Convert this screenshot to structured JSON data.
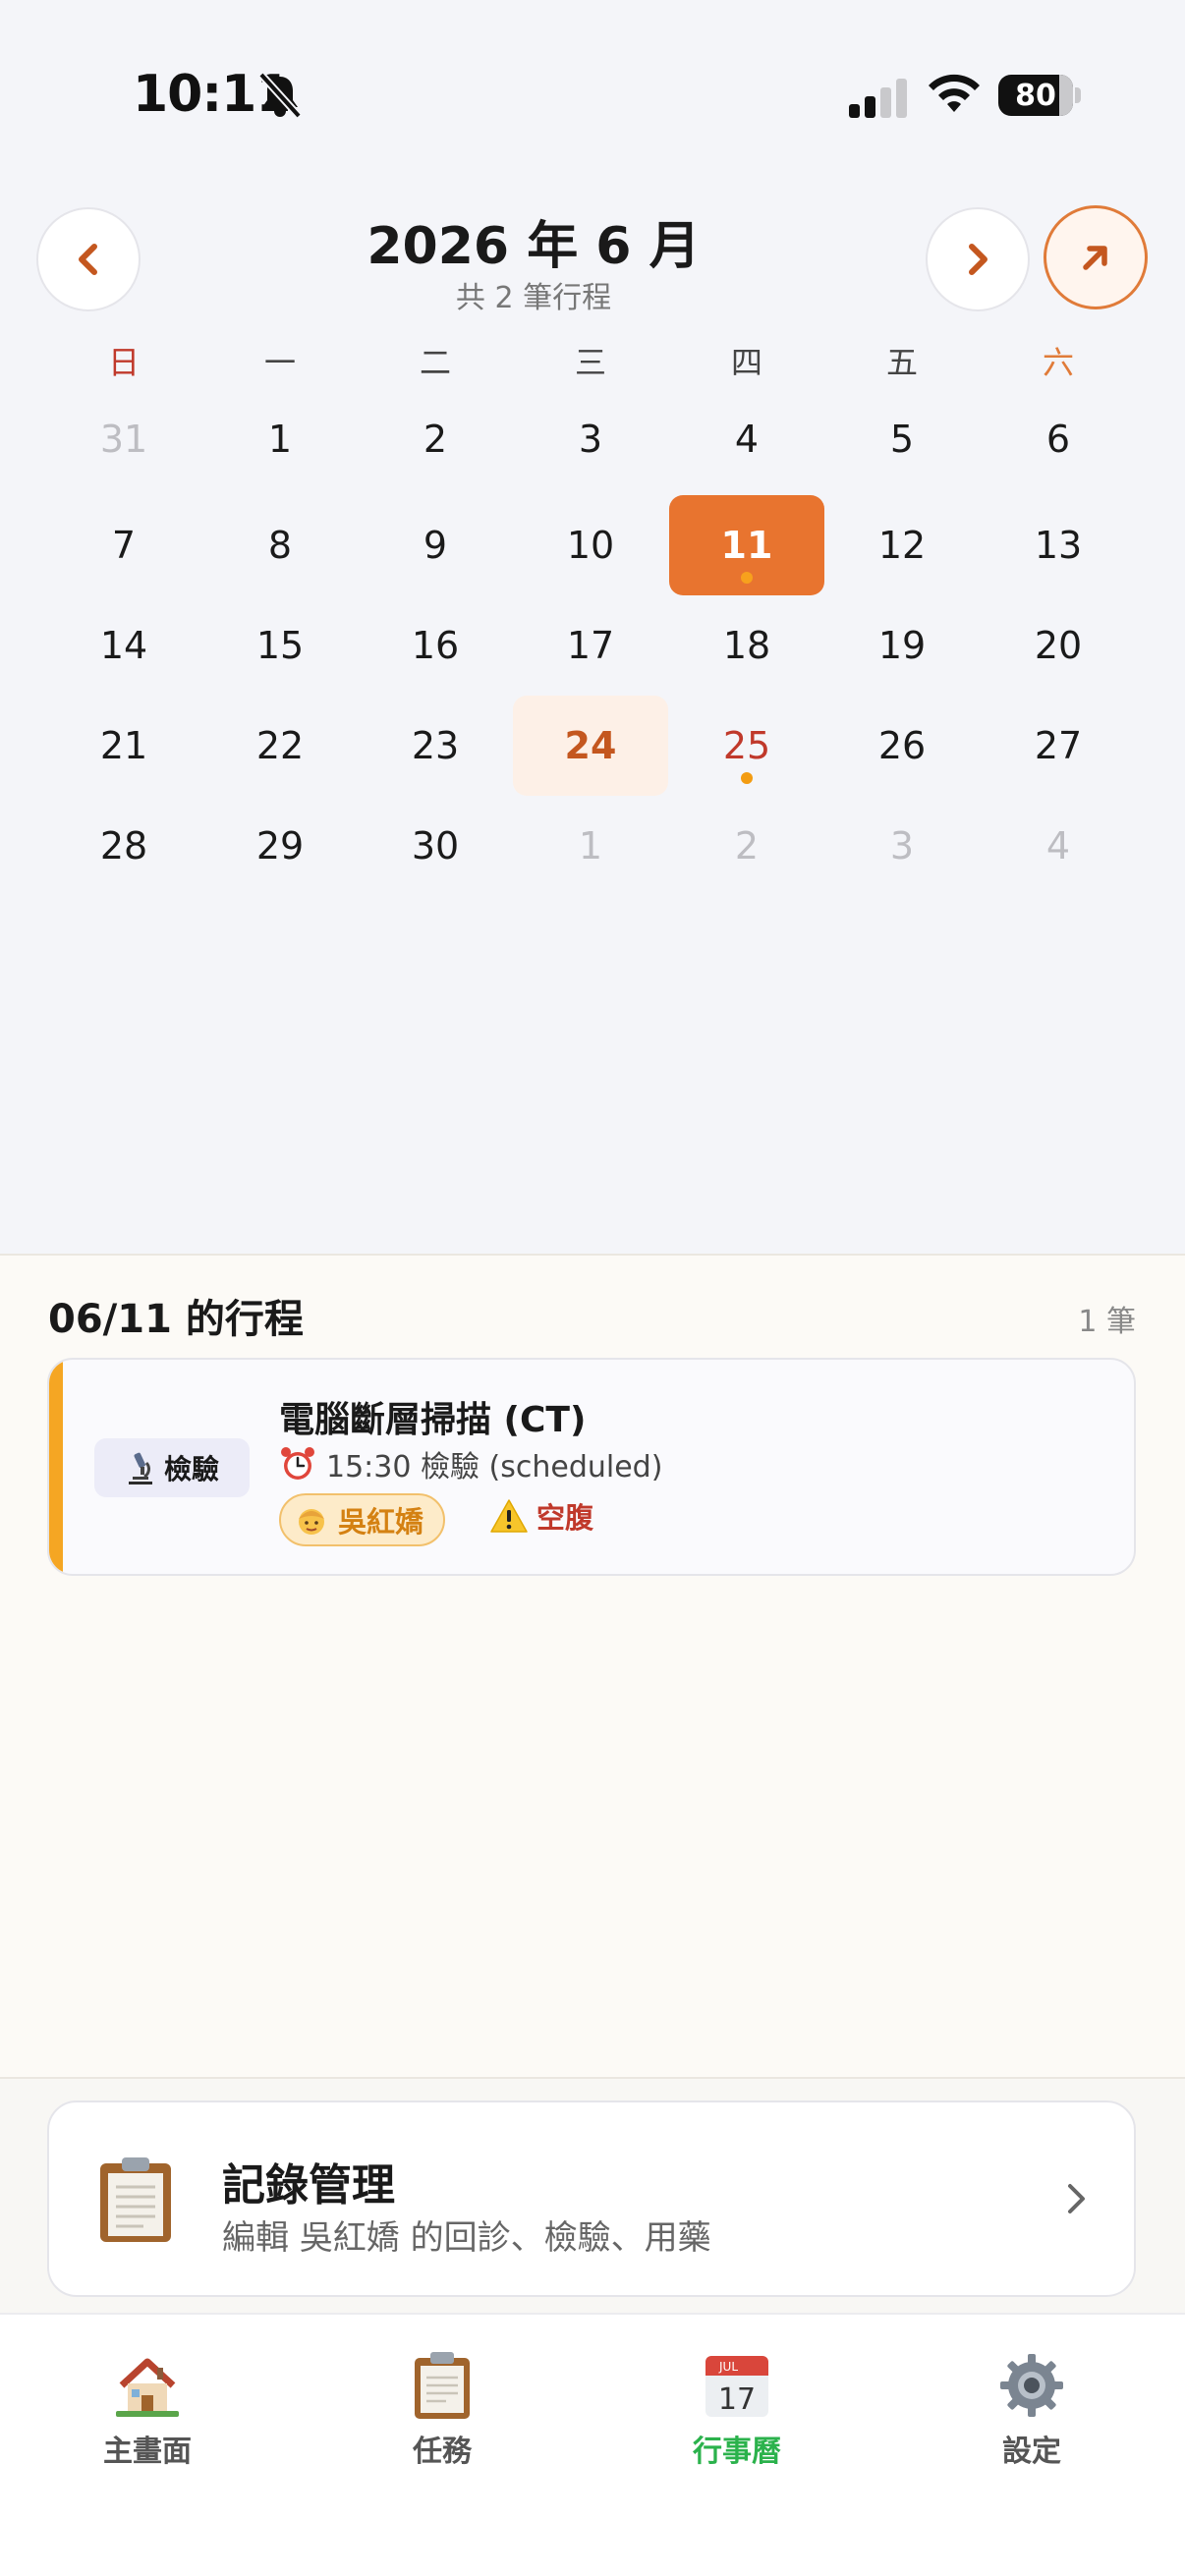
{
  "status_bar": {
    "time": "10:11",
    "battery": "80",
    "icons": [
      "bell-slash-icon",
      "cellular-signal-icon",
      "wifi-icon",
      "battery-icon"
    ]
  },
  "calendar": {
    "month_title": "2026 年 6 月",
    "subtitle": "共 2 筆行程",
    "prev_icon": "chevron-left-icon",
    "next_icon": "chevron-right-icon",
    "expand_icon": "arrow-up-right-icon",
    "weekdays": [
      "日",
      "一",
      "二",
      "三",
      "四",
      "五",
      "六"
    ],
    "days": [
      [
        "31",
        "1",
        "2",
        "3",
        "4",
        "5",
        "6"
      ],
      [
        "7",
        "8",
        "9",
        "10",
        "11",
        "12",
        "13"
      ],
      [
        "14",
        "15",
        "16",
        "17",
        "18",
        "19",
        "20"
      ],
      [
        "21",
        "22",
        "23",
        "24",
        "25",
        "26",
        "27"
      ],
      [
        "28",
        "29",
        "30",
        "1",
        "2",
        "3",
        "4"
      ]
    ],
    "selected_day": "11",
    "today": "24",
    "event_dots": [
      "11",
      "25"
    ],
    "accent_color": "#e8742f"
  },
  "schedule": {
    "title": "06/11 的行程",
    "count": "1 筆",
    "event": {
      "type_icon": "microscope-icon",
      "type_label": "檢驗",
      "title": "電腦斷層掃描 (CT)",
      "time_icon": "alarm-clock-icon",
      "meta": "15:30  檢驗 (scheduled)",
      "person_icon": "person-icon",
      "person": "吳紅嬌",
      "warning_icon": "warning-icon",
      "warning": "空腹",
      "accent_color": "#f5a623"
    }
  },
  "records": {
    "icon": "clipboard-icon",
    "title": "記錄管理",
    "subtitle": "編輯 吳紅嬌 的回診、檢驗、用藥"
  },
  "tabs": [
    {
      "label": "主畫面",
      "icon": "house-icon"
    },
    {
      "label": "任務",
      "icon": "clipboard-icon"
    },
    {
      "label": "行事曆",
      "icon": "calendar-icon",
      "active": true
    },
    {
      "label": "設定",
      "icon": "gear-icon"
    }
  ]
}
